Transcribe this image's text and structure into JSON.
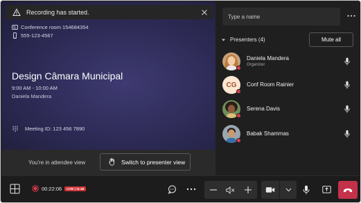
{
  "toast": {
    "message": "Recording has started."
  },
  "meeting": {
    "room": "Conference room 154684354",
    "phone": "555-123-4567",
    "title": "Design Câmara Municipal",
    "time": "9:00 AM - 10:00 AM",
    "organizer": "Daniela Mandera",
    "meeting_id": "Meeting ID: 123 456 7890"
  },
  "attendee_bar": {
    "text": "You're in attendee view",
    "switch_button": "Switch to presenter view"
  },
  "panel": {
    "search_placeholder": "Type a name",
    "presenters_label": "Presenters (4)",
    "mute_all": "Mute all",
    "presenters": [
      {
        "name": "Daniela Mandera",
        "role": "Organizer",
        "avatar": "photo"
      },
      {
        "name": "Conf Room Rainier",
        "role": "",
        "avatar": "initials",
        "initials": "CG"
      },
      {
        "name": "Serena Davis",
        "role": "",
        "avatar": "photo"
      },
      {
        "name": "Babak Shammas",
        "role": "",
        "avatar": "photo"
      }
    ]
  },
  "controls": {
    "recording_time": "00:22:06",
    "live_badge": "LIVE | 11:46"
  },
  "colors": {
    "stage_accent": "#3e3a72",
    "status_red": "#e03a4a",
    "hangup_red": "#c4314b"
  },
  "icons": [
    "warning-icon",
    "close-icon",
    "conference-room-icon",
    "phone-icon",
    "dialpad-icon",
    "hand-icon",
    "more-icon",
    "chevron-down-icon",
    "microphone-icon",
    "apps-icon",
    "record-icon",
    "chat-icon",
    "minus-icon",
    "volume-mute-icon",
    "plus-icon",
    "camera-icon",
    "share-screen-icon",
    "hang-up-icon"
  ]
}
